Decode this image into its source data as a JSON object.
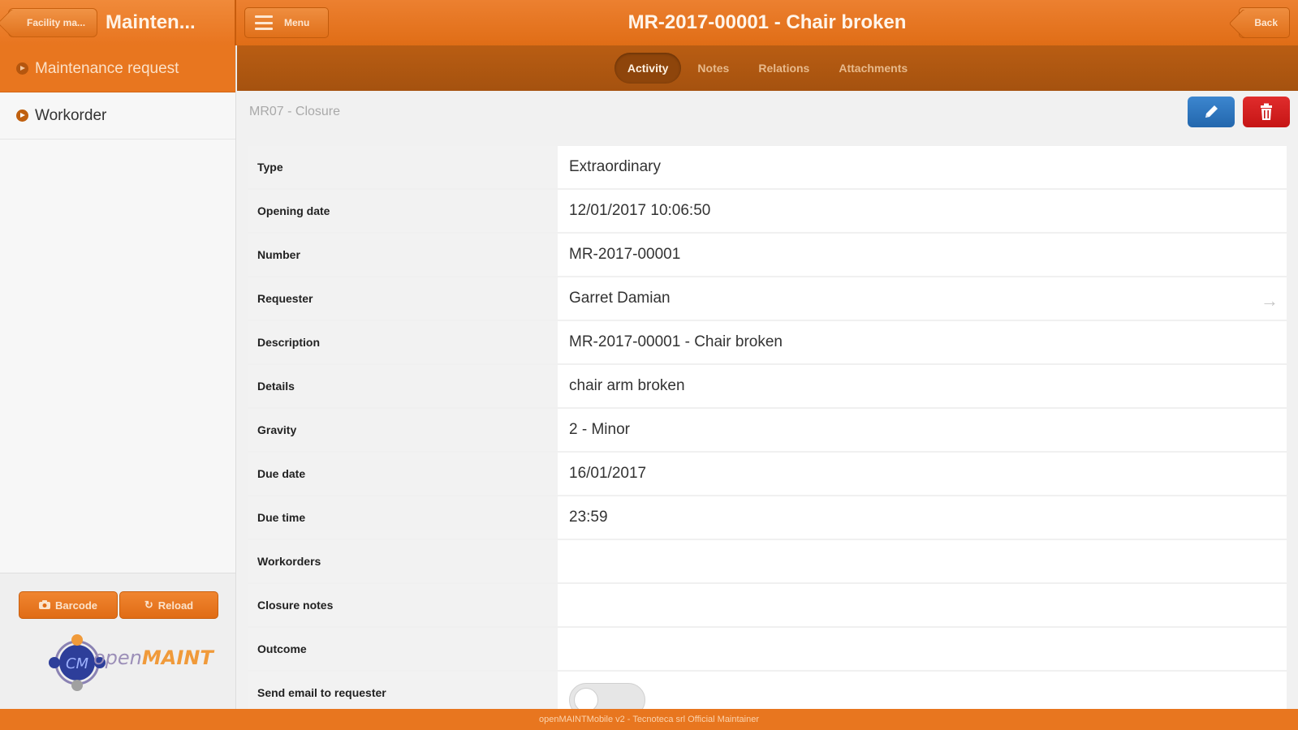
{
  "header": {
    "back_chip": "Facility ma...",
    "app_title": "Mainten...",
    "menu_label": "Menu",
    "page_title": "MR-2017-00001 - Chair broken",
    "back_label": "Back",
    "color_primary": "#e8761f"
  },
  "sidebar": {
    "items": [
      {
        "label": "Maintenance request",
        "active": true
      },
      {
        "label": "Workorder",
        "active": false
      }
    ],
    "barcode_label": "Barcode",
    "reload_label": "Reload",
    "logo_text_a": "open",
    "logo_text_b": "MAINT",
    "logo_letters": "CM"
  },
  "tabs": [
    {
      "label": "Activity",
      "active": true
    },
    {
      "label": "Notes",
      "active": false
    },
    {
      "label": "Relations",
      "active": false
    },
    {
      "label": "Attachments",
      "active": false
    }
  ],
  "main": {
    "subtitle": "MR07 - Closure",
    "fields": [
      {
        "label": "Type",
        "value": "Extraordinary"
      },
      {
        "label": "Opening date",
        "value": "12/01/2017 10:06:50"
      },
      {
        "label": "Number",
        "value": "MR-2017-00001"
      },
      {
        "label": "Requester",
        "value": "Garret Damian"
      },
      {
        "label": "Description",
        "value": "MR-2017-00001 - Chair broken"
      },
      {
        "label": "Details",
        "value": "chair arm broken"
      },
      {
        "label": "Gravity",
        "value": "2 - Minor"
      },
      {
        "label": "Due date",
        "value": "16/01/2017"
      },
      {
        "label": "Due time",
        "value": "23:59"
      },
      {
        "label": "Workorders",
        "value": ""
      },
      {
        "label": "Closure notes",
        "value": ""
      },
      {
        "label": "Outcome",
        "value": ""
      },
      {
        "label": "Send email to requester",
        "value": ""
      }
    ],
    "send_email_toggle": false
  },
  "footer": {
    "text": "openMAINTMobile v2 - Tecnoteca srl Official Maintainer"
  }
}
